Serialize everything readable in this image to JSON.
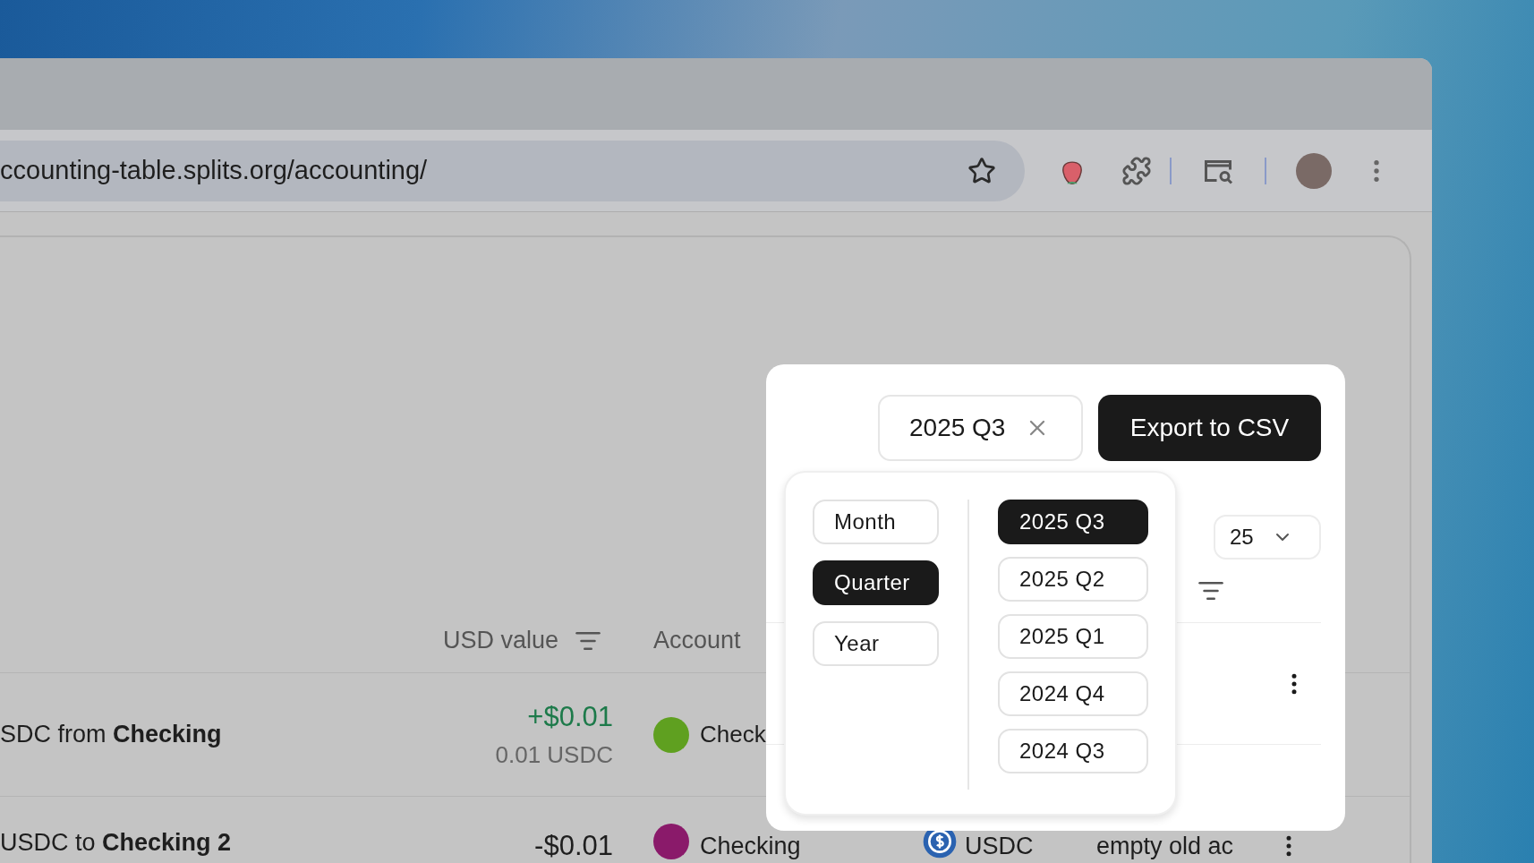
{
  "browser": {
    "url": "ccounting-table.splits.org/accounting/"
  },
  "table": {
    "columns": [
      {
        "label": "USD value"
      },
      {
        "label": "Account"
      }
    ],
    "rows": [
      {
        "description": "SDC from **Checking**",
        "usd": "+$0.01",
        "kind": "credit",
        "amount": "0.01 USDC",
        "account": "Check",
        "color": "#5fa020"
      },
      {
        "description": "USDC to **Checking 2**",
        "usd": "-$0.01",
        "kind": "debit",
        "account": "Checking",
        "color": "#8a1a6a",
        "token": "USDC",
        "memo": "empty old ac"
      }
    ]
  },
  "period_filter": {
    "value": "2025 Q3"
  },
  "export_button": "Export to CSV",
  "page_size": "25",
  "period_picker": {
    "granularities": [
      {
        "label": "Month",
        "selected": false
      },
      {
        "label": "Quarter",
        "selected": true
      },
      {
        "label": "Year",
        "selected": false
      }
    ],
    "periods": [
      {
        "label": "2025 Q3",
        "selected": true
      },
      {
        "label": "2025 Q2",
        "selected": false
      },
      {
        "label": "2025 Q1",
        "selected": false
      },
      {
        "label": "2024 Q4",
        "selected": false
      },
      {
        "label": "2024 Q3",
        "selected": false
      }
    ]
  }
}
